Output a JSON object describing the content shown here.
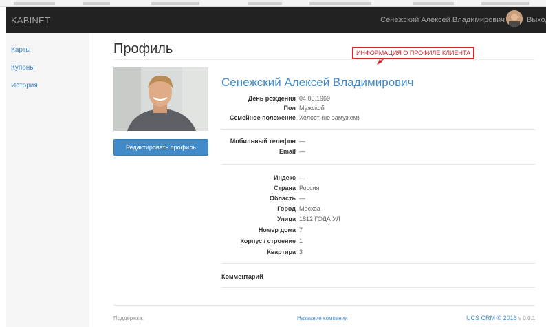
{
  "navbar": {
    "brand": "KABINET",
    "user_name": "Сенежский Алексей Владимирович",
    "logout": "Выход"
  },
  "sidebar": {
    "items": [
      {
        "label": "Карты"
      },
      {
        "label": "Купоны"
      },
      {
        "label": "История"
      }
    ]
  },
  "page": {
    "title": "Профиль",
    "annotation": "ИНФОРМАЦИЯ О ПРОФИЛЕ КЛИЕНТА",
    "edit_button": "Редактировать профиль"
  },
  "profile": {
    "name": "Сенежский Алексей Владимирович",
    "personal": [
      {
        "label": "День рождения",
        "value": "04.05.1969"
      },
      {
        "label": "Пол",
        "value": "Мужской"
      },
      {
        "label": "Семейное положение",
        "value": "Холост (не замужем)"
      }
    ],
    "contacts": [
      {
        "label": "Мобильный телефон",
        "value": "—"
      },
      {
        "label": "Email",
        "value": "—"
      }
    ],
    "address": [
      {
        "label": "Индекс",
        "value": "—"
      },
      {
        "label": "Страна",
        "value": "Россия"
      },
      {
        "label": "Область",
        "value": "—"
      },
      {
        "label": "Город",
        "value": "Москва"
      },
      {
        "label": "Улица",
        "value": "1812 ГОДА УЛ"
      },
      {
        "label": "Номер дома",
        "value": "7"
      },
      {
        "label": "Корпус / строение",
        "value": "1"
      },
      {
        "label": "Квартира",
        "value": "3"
      }
    ],
    "comment_label": "Комментарий"
  },
  "footer": {
    "support": "Поддержка:",
    "company": "Название компании",
    "crm": "UCS CRM © 2016",
    "version": "v 0.0.1"
  },
  "colors": {
    "navbar_bg": "#222222",
    "link": "#428bca",
    "annotation": "#d9262c"
  }
}
